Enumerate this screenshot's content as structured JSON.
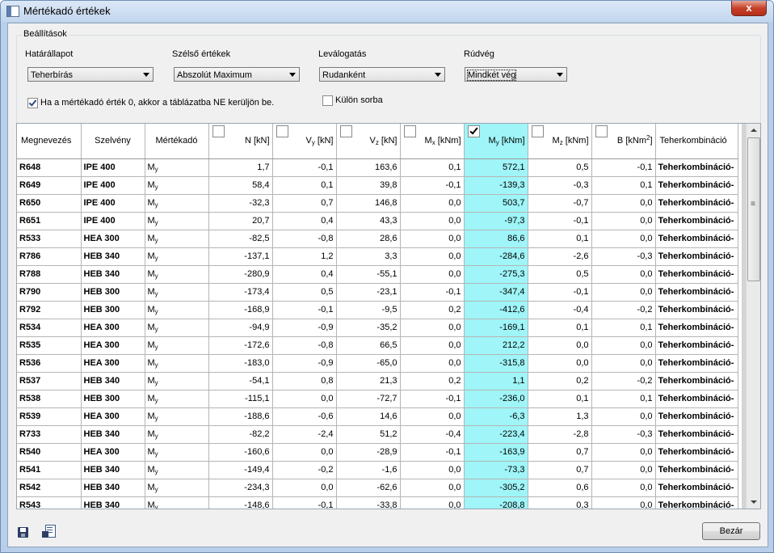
{
  "window": {
    "title": "Mértékadó értékek",
    "close_glyph": "x"
  },
  "settings": {
    "legend": "Beállítások",
    "hatarallapot": {
      "label": "Határállapot",
      "value": "Teherbírás"
    },
    "szelso": {
      "label": "Szélső értékek",
      "value": "Abszolút Maximum"
    },
    "levalogatas": {
      "label": "Leválogatás",
      "value": "Rudanként"
    },
    "rudveg": {
      "label": "Rúdvég",
      "value": "Mindkét vég"
    },
    "zero_check": {
      "label": "Ha a mértékadó érték 0, akkor a táblázatba NE kerüljön be.",
      "checked": true
    },
    "kulon_check": {
      "label": "Külön sorba",
      "checked": false
    }
  },
  "table": {
    "headers": {
      "name": "Megnevezés",
      "section": "Szelvény",
      "govern": "Mértékadó",
      "N": "N [kN]",
      "Vy_main": "V",
      "Vy_sub": "y",
      "Vy_unit": " [kN]",
      "Vz_main": "V",
      "Vz_sub": "z",
      "Vz_unit": " [kN]",
      "Mx_main": "M",
      "Mx_sub": "x",
      "Mx_unit": " [kNm]",
      "My_main": "M",
      "My_sub": "y",
      "My_unit": " [kNm]",
      "Mz_main": "M",
      "Mz_sub": "z",
      "Mz_unit": " [kNm]",
      "B_main": "B [kNm",
      "B_sup": "2",
      "B_close": "]",
      "comb": "Teherkombináció"
    },
    "column_checks": {
      "N": false,
      "Vy": false,
      "Vz": false,
      "Mx": false,
      "My": true,
      "Mz": false,
      "B": false
    },
    "highlight_color": "#9ff5f8",
    "rows": [
      {
        "name": "R648",
        "sec": "IPE 400",
        "gov": "M",
        "gov_sub": "y",
        "N": "1,7",
        "Vy": "-0,1",
        "Vz": "163,6",
        "Mx": "0,1",
        "My": "572,1",
        "Mz": "0,5",
        "B": "-0,1",
        "comb": "Teherkombináció-"
      },
      {
        "name": "R649",
        "sec": "IPE 400",
        "gov": "M",
        "gov_sub": "y",
        "N": "58,4",
        "Vy": "0,1",
        "Vz": "39,8",
        "Mx": "-0,1",
        "My": "-139,3",
        "Mz": "-0,3",
        "B": "0,1",
        "comb": "Teherkombináció-"
      },
      {
        "name": "R650",
        "sec": "IPE 400",
        "gov": "M",
        "gov_sub": "y",
        "N": "-32,3",
        "Vy": "0,7",
        "Vz": "146,8",
        "Mx": "0,0",
        "My": "503,7",
        "Mz": "-0,7",
        "B": "0,0",
        "comb": "Teherkombináció-"
      },
      {
        "name": "R651",
        "sec": "IPE 400",
        "gov": "M",
        "gov_sub": "y",
        "N": "20,7",
        "Vy": "0,4",
        "Vz": "43,3",
        "Mx": "0,0",
        "My": "-97,3",
        "Mz": "-0,1",
        "B": "0,0",
        "comb": "Teherkombináció-"
      },
      {
        "name": "R533",
        "sec": "HEA 300",
        "gov": "M",
        "gov_sub": "y",
        "N": "-82,5",
        "Vy": "-0,8",
        "Vz": "28,6",
        "Mx": "0,0",
        "My": "86,6",
        "Mz": "0,1",
        "B": "0,0",
        "comb": "Teherkombináció-"
      },
      {
        "name": "R786",
        "sec": "HEB 340",
        "gov": "M",
        "gov_sub": "y",
        "N": "-137,1",
        "Vy": "1,2",
        "Vz": "3,3",
        "Mx": "0,0",
        "My": "-284,6",
        "Mz": "-2,6",
        "B": "-0,3",
        "comb": "Teherkombináció-"
      },
      {
        "name": "R788",
        "sec": "HEB 340",
        "gov": "M",
        "gov_sub": "y",
        "N": "-280,9",
        "Vy": "0,4",
        "Vz": "-55,1",
        "Mx": "0,0",
        "My": "-275,3",
        "Mz": "0,5",
        "B": "0,0",
        "comb": "Teherkombináció-"
      },
      {
        "name": "R790",
        "sec": "HEB 300",
        "gov": "M",
        "gov_sub": "y",
        "N": "-173,4",
        "Vy": "0,5",
        "Vz": "-23,1",
        "Mx": "-0,1",
        "My": "-347,4",
        "Mz": "-0,1",
        "B": "0,0",
        "comb": "Teherkombináció-"
      },
      {
        "name": "R792",
        "sec": "HEB 300",
        "gov": "M",
        "gov_sub": "y",
        "N": "-168,9",
        "Vy": "-0,1",
        "Vz": "-9,5",
        "Mx": "0,2",
        "My": "-412,6",
        "Mz": "-0,4",
        "B": "-0,2",
        "comb": "Teherkombináció-"
      },
      {
        "name": "R534",
        "sec": "HEA 300",
        "gov": "M",
        "gov_sub": "y",
        "N": "-94,9",
        "Vy": "-0,9",
        "Vz": "-35,2",
        "Mx": "0,0",
        "My": "-169,1",
        "Mz": "0,1",
        "B": "0,1",
        "comb": "Teherkombináció-"
      },
      {
        "name": "R535",
        "sec": "HEA 300",
        "gov": "M",
        "gov_sub": "y",
        "N": "-172,6",
        "Vy": "-0,8",
        "Vz": "66,5",
        "Mx": "0,0",
        "My": "212,2",
        "Mz": "0,0",
        "B": "0,0",
        "comb": "Teherkombináció-"
      },
      {
        "name": "R536",
        "sec": "HEA 300",
        "gov": "M",
        "gov_sub": "y",
        "N": "-183,0",
        "Vy": "-0,9",
        "Vz": "-65,0",
        "Mx": "0,0",
        "My": "-315,8",
        "Mz": "0,0",
        "B": "0,0",
        "comb": "Teherkombináció-"
      },
      {
        "name": "R537",
        "sec": "HEB 340",
        "gov": "M",
        "gov_sub": "y",
        "N": "-54,1",
        "Vy": "0,8",
        "Vz": "21,3",
        "Mx": "0,2",
        "My": "1,1",
        "Mz": "0,2",
        "B": "-0,2",
        "comb": "Teherkombináció-"
      },
      {
        "name": "R538",
        "sec": "HEB 300",
        "gov": "M",
        "gov_sub": "y",
        "N": "-115,1",
        "Vy": "0,0",
        "Vz": "-72,7",
        "Mx": "-0,1",
        "My": "-236,0",
        "Mz": "0,1",
        "B": "0,1",
        "comb": "Teherkombináció-"
      },
      {
        "name": "R539",
        "sec": "HEA 300",
        "gov": "M",
        "gov_sub": "y",
        "N": "-188,6",
        "Vy": "-0,6",
        "Vz": "14,6",
        "Mx": "0,0",
        "My": "-6,3",
        "Mz": "1,3",
        "B": "0,0",
        "comb": "Teherkombináció-"
      },
      {
        "name": "R733",
        "sec": "HEB 340",
        "gov": "M",
        "gov_sub": "y",
        "N": "-82,2",
        "Vy": "-2,4",
        "Vz": "51,2",
        "Mx": "-0,4",
        "My": "-223,4",
        "Mz": "-2,8",
        "B": "-0,3",
        "comb": "Teherkombináció-"
      },
      {
        "name": "R540",
        "sec": "HEA 300",
        "gov": "M",
        "gov_sub": "y",
        "N": "-160,6",
        "Vy": "0,0",
        "Vz": "-28,9",
        "Mx": "-0,1",
        "My": "-163,9",
        "Mz": "0,7",
        "B": "0,0",
        "comb": "Teherkombináció-"
      },
      {
        "name": "R541",
        "sec": "HEB 340",
        "gov": "M",
        "gov_sub": "y",
        "N": "-149,4",
        "Vy": "-0,2",
        "Vz": "-1,6",
        "Mx": "0,0",
        "My": "-73,3",
        "Mz": "0,7",
        "B": "0,0",
        "comb": "Teherkombináció-"
      },
      {
        "name": "R542",
        "sec": "HEB 340",
        "gov": "M",
        "gov_sub": "y",
        "N": "-234,3",
        "Vy": "0,0",
        "Vz": "-62,6",
        "Mx": "0,0",
        "My": "-305,2",
        "Mz": "0,6",
        "B": "0,0",
        "comb": "Teherkombináció-"
      },
      {
        "name": "R543",
        "sec": "HEB 340",
        "gov": "M",
        "gov_sub": "y",
        "N": "-148,6",
        "Vy": "-0,1",
        "Vz": "-33,8",
        "Mx": "0,0",
        "My": "-208,8",
        "Mz": "0,3",
        "B": "0,0",
        "comb": "Teherkombináció-"
      }
    ]
  },
  "footer": {
    "save_icon": "save-icon",
    "export_icon": "export-icon",
    "close_label": "Bezár"
  }
}
